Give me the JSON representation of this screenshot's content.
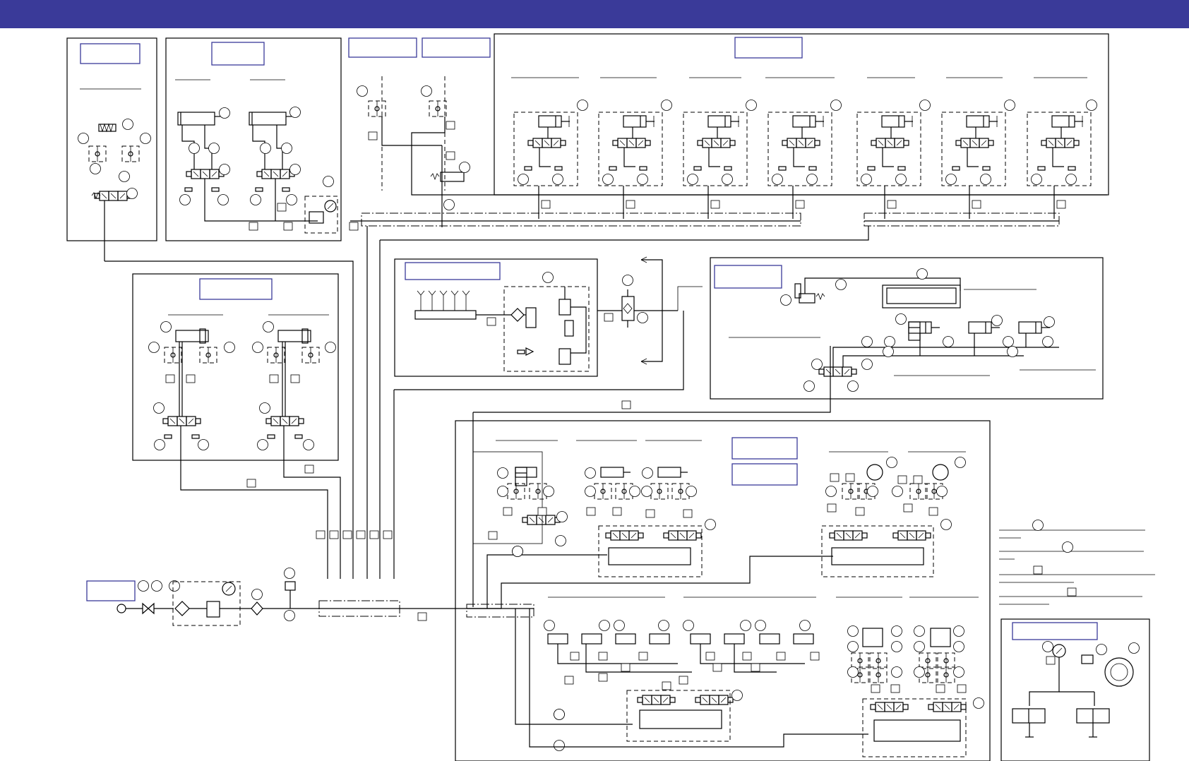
{
  "colors": {
    "header_bar": "#3a3a99",
    "label_border": "#3a3a99",
    "line": "#000000",
    "background": "#ffffff"
  },
  "header": {
    "title": ""
  },
  "icons": [
    "pneumatic-cylinder-icon",
    "solenoid-valve-icon",
    "check-valve-icon",
    "pressure-gauge-icon",
    "filter-icon",
    "shutoff-valve-icon",
    "regulator-icon",
    "muffler-icon",
    "vacuum-ejector-icon",
    "suction-cup-icon",
    "pressure-switch-icon"
  ]
}
